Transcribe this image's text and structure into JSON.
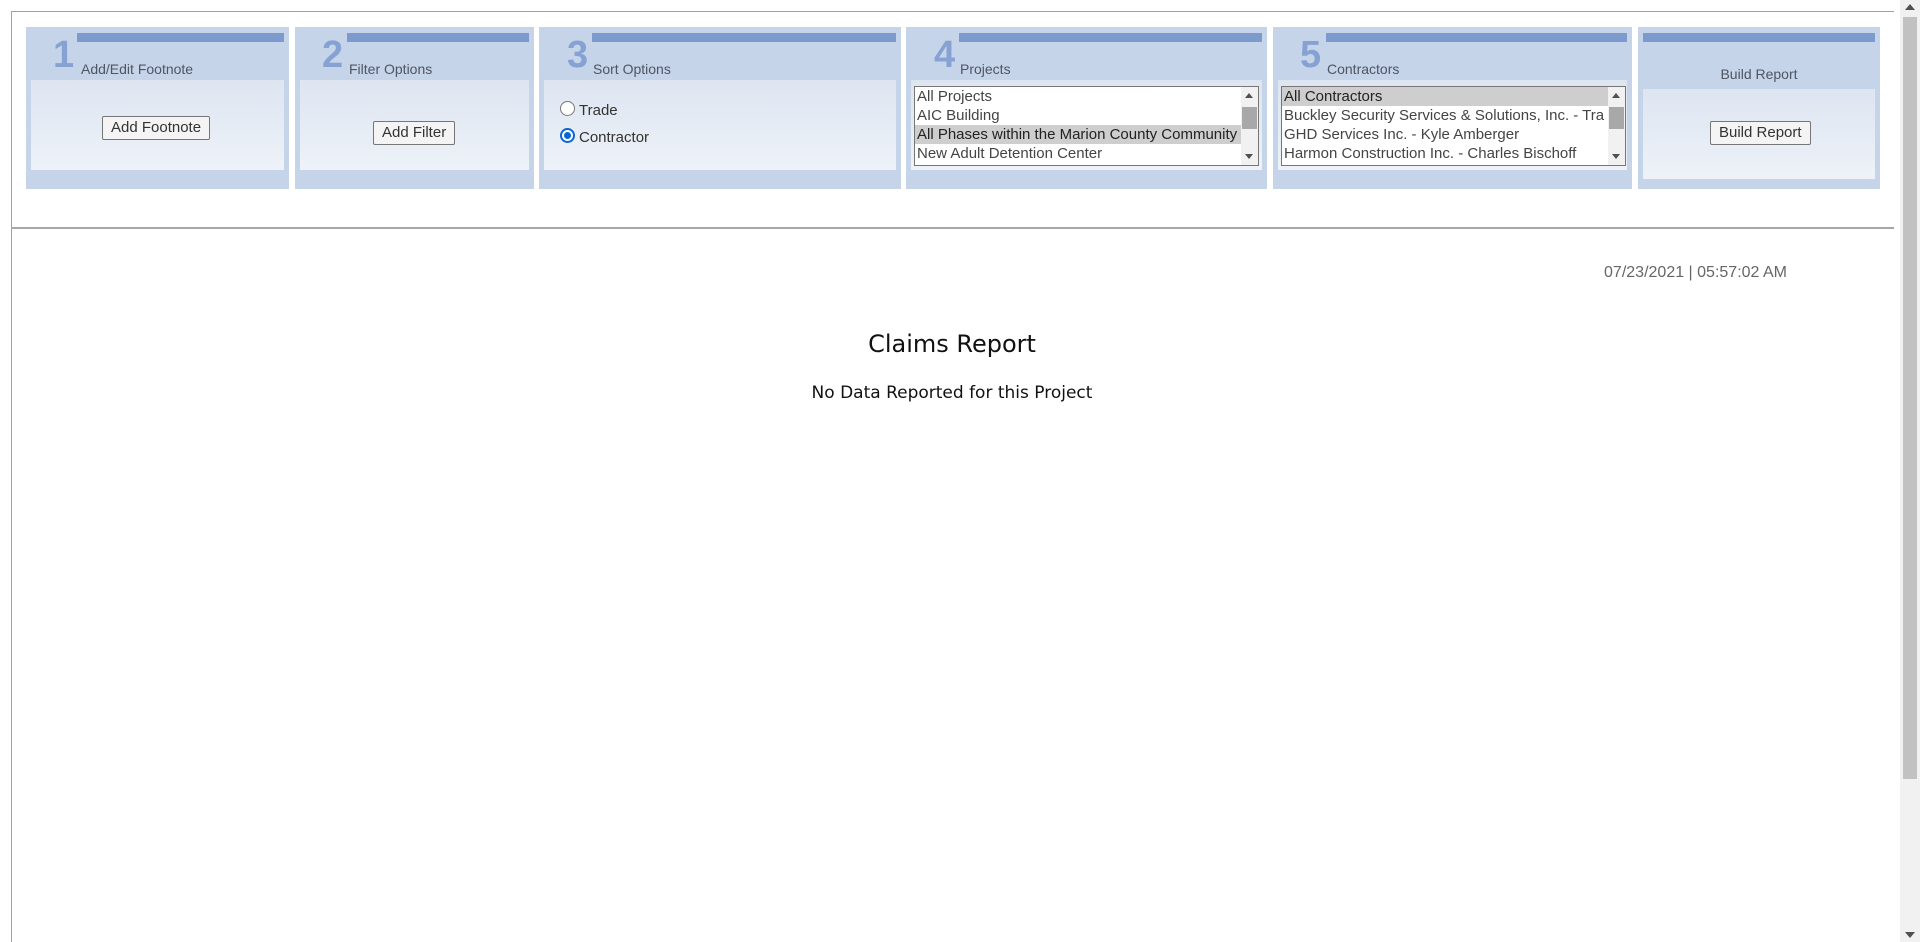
{
  "steps": [
    {
      "number": "1",
      "title": "Add/Edit Footnote",
      "button_label": "Add Footnote"
    },
    {
      "number": "2",
      "title": "Filter Options",
      "button_label": "Add Filter"
    },
    {
      "number": "3",
      "title": "Sort Options",
      "options": [
        {
          "label": "Trade",
          "checked": false
        },
        {
          "label": "Contractor",
          "checked": true
        }
      ]
    },
    {
      "number": "4",
      "title": "Projects",
      "items": [
        {
          "label": "All Projects",
          "selected": false
        },
        {
          "label": "AIC Building",
          "selected": false
        },
        {
          "label": "All Phases within the Marion County Community",
          "selected": true
        },
        {
          "label": "New Adult Detention Center",
          "selected": false
        }
      ]
    },
    {
      "number": "5",
      "title": "Contractors",
      "items": [
        {
          "label": "All Contractors",
          "selected": true
        },
        {
          "label": "Buckley Security Services & Solutions, Inc. - Tra",
          "selected": false
        },
        {
          "label": "GHD Services Inc. - Kyle Amberger",
          "selected": false
        },
        {
          "label": "Harmon Construction Inc. - Charles Bischoff",
          "selected": false
        }
      ]
    },
    {
      "title": "Build Report",
      "button_label": "Build Report"
    }
  ],
  "report": {
    "timestamp": "07/23/2021 | 05:57:02 AM",
    "title": "Claims Report",
    "empty_message": "No Data Reported for this Project"
  },
  "colors": {
    "panel": "#c5d4e9",
    "accent": "#7d9acd",
    "number": "#86a2d3",
    "radio_checked": "#0a66d6"
  }
}
